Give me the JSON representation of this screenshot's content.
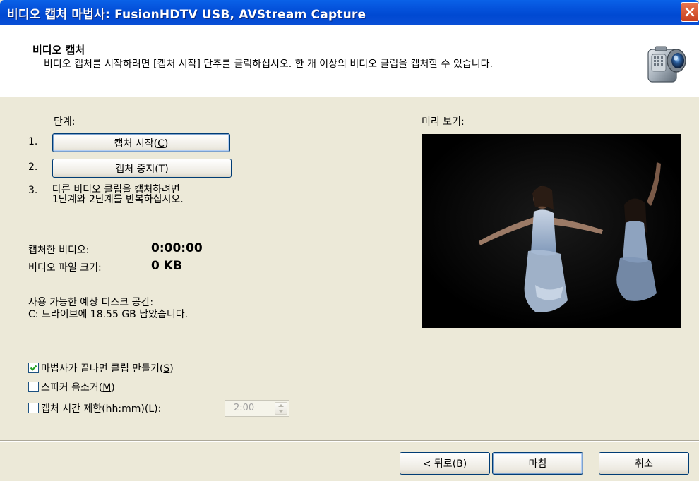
{
  "window": {
    "title": "비디오 캡처 마법사: FusionHDTV USB, AVStream Capture"
  },
  "header": {
    "title": "비디오 캡처",
    "description": "비디오 캡처를 시작하려면 [캡처 시작] 단추를 클릭하십시오. 한 개 이상의 비디오 클립을 캡처할 수 있습니다."
  },
  "steps": {
    "label": "단계:",
    "step1_num": "1.",
    "start_prefix": "캡처 시작(",
    "start_key": "C",
    "start_suffix": ")",
    "step2_num": "2.",
    "stop_prefix": "캡처 중지(",
    "stop_key": "T",
    "stop_suffix": ")",
    "step3_num": "3.",
    "step3_line1": "다른 비디오 클립을 캡처하려면",
    "step3_line2": "1단계와 2단계를 반복하십시오."
  },
  "stats": {
    "captured_label": "캡처한 비디오:",
    "captured_value": "0:00:00",
    "size_label": "비디오 파일 크기:",
    "size_value": "0 KB"
  },
  "disk": {
    "label": "사용 가능한 예상 디스크 공간:",
    "value": "C: 드라이브에 18.55 GB 남았습니다."
  },
  "options": {
    "make_clips_prefix": "마법사가 끝나면 클립 만들기(",
    "make_clips_key": "S",
    "make_clips_suffix": ")",
    "make_clips_checked": true,
    "mute_prefix": "스피커 음소거(",
    "mute_key": "M",
    "mute_suffix": ")",
    "mute_checked": false,
    "limit_prefix": "캡처 시간 제한(hh:mm)(",
    "limit_key": "L",
    "limit_suffix": "):",
    "limit_checked": false,
    "limit_value": "2:00"
  },
  "preview": {
    "label": "미리 보기:"
  },
  "buttons": {
    "back_prefix": "< 뒤로(",
    "back_key": "B",
    "back_suffix": ")",
    "finish": "마침",
    "cancel": "취소"
  },
  "colors": {
    "titlebar": "#0049d2",
    "dialog_bg": "#ece9d8",
    "check_mark": "#21a121"
  },
  "icons": {
    "close": "close-icon",
    "camera": "video-camera-icon",
    "check": "checkmark-icon",
    "spinner": "spinner-arrows-icon"
  }
}
